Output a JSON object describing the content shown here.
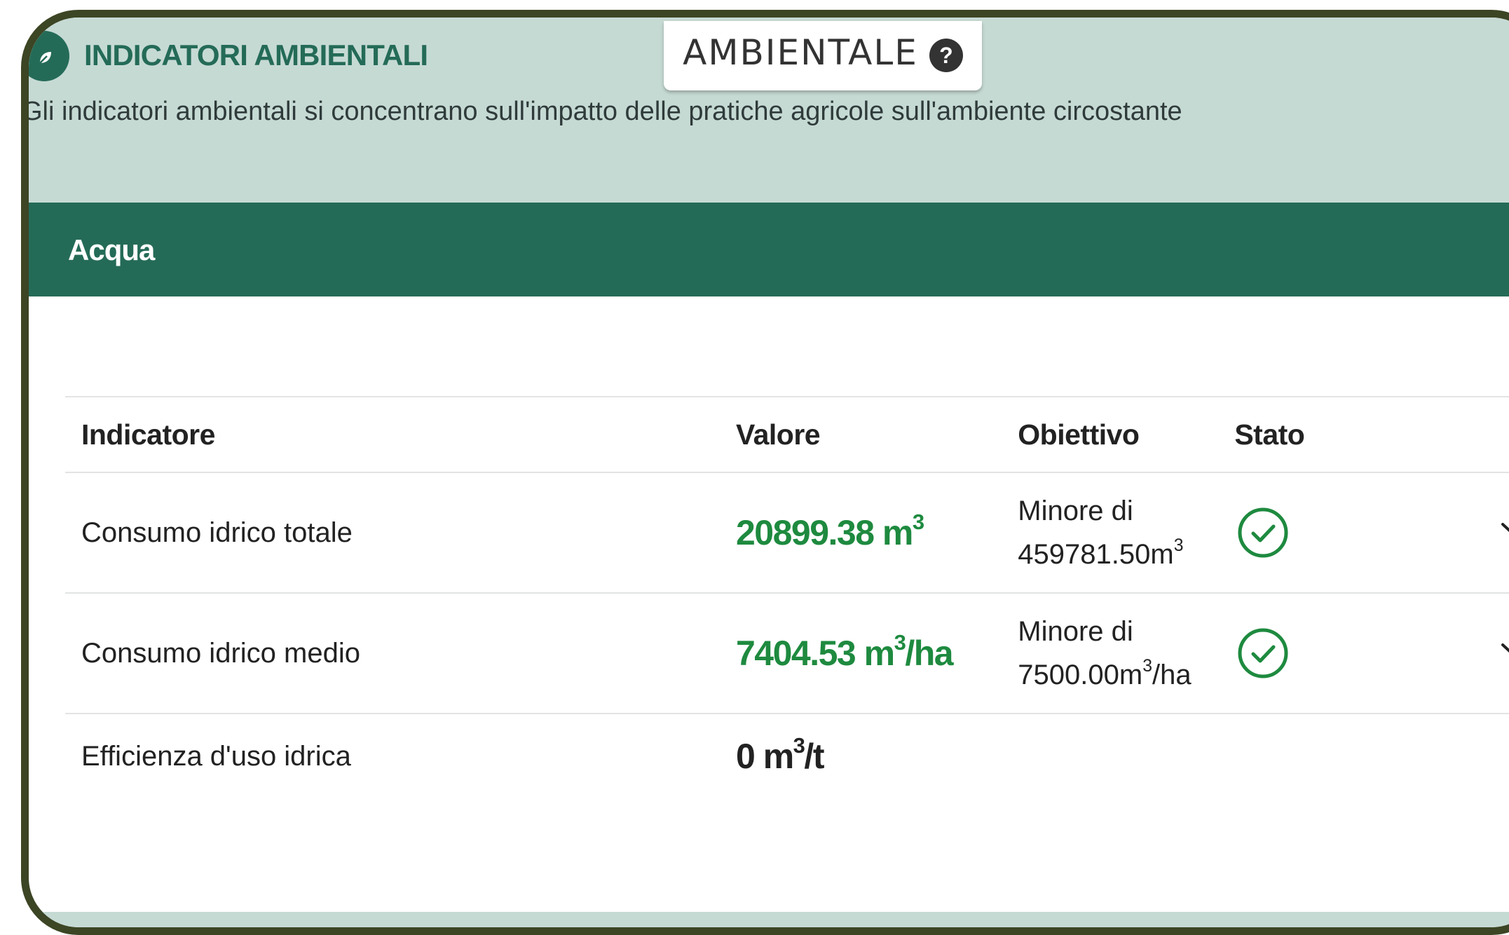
{
  "header": {
    "icon": "leaf-icon",
    "title": "INDICATORI AMBIENTALI",
    "description": "Gli indicatori ambientali si concentrano sull'impatto delle pratiche agricole sull'ambiente circostante"
  },
  "tab": {
    "label": "AMBIENTALE",
    "help_icon": "?"
  },
  "category": {
    "title": "Acqua"
  },
  "table": {
    "columns": {
      "indicator": "Indicatore",
      "value": "Valore",
      "target": "Obiettivo",
      "status": "Stato"
    },
    "rows": [
      {
        "indicator": "Consumo idrico totale",
        "value": "20899.38 m",
        "value_sup": "3",
        "value_suffix": "",
        "target_prefix": "Minore di",
        "target_value": "459781.50m",
        "target_sup": "3",
        "target_suffix": "",
        "status": "check-circle-icon",
        "expand": "chevron-down-icon"
      },
      {
        "indicator": "Consumo idrico medio",
        "value": "7404.53 m",
        "value_sup": "3",
        "value_suffix": "/ha",
        "target_prefix": "Minore di",
        "target_value": "7500.00m",
        "target_sup": "3",
        "target_suffix": "/ha",
        "status": "check-circle-icon",
        "expand": "chevron-down-icon"
      },
      {
        "indicator": "Efficienza d'uso idrica",
        "value": "0 m",
        "value_sup": "3",
        "value_suffix": "/t"
      }
    ]
  },
  "colors": {
    "brand_green": "#246b57",
    "ok_green": "#1e8a3f",
    "header_bg": "#c6dad4",
    "frame": "#3c4524"
  }
}
